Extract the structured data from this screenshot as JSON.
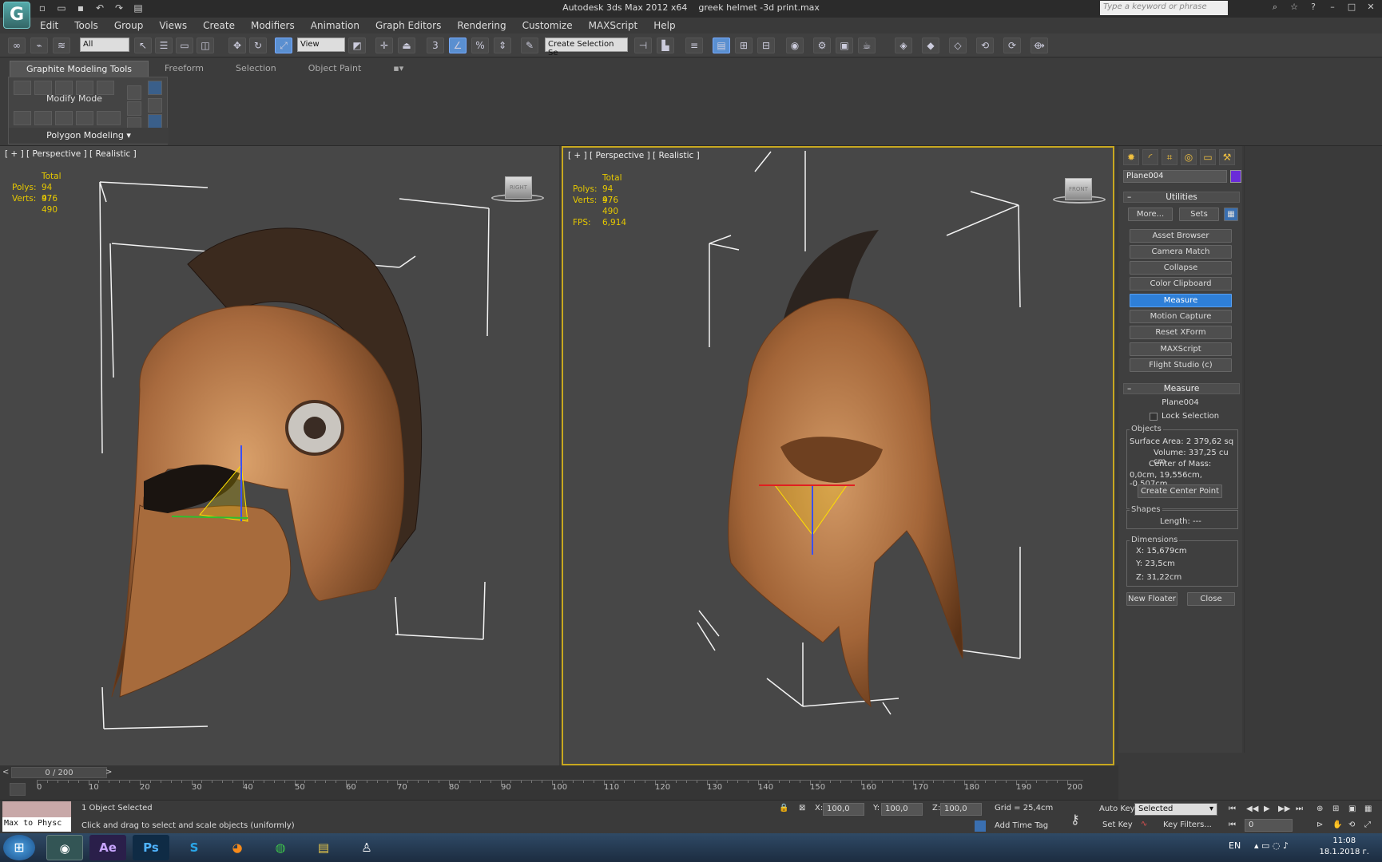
{
  "title_bar": {
    "app": "Autodesk 3ds Max  2012 x64",
    "file": "greek helmet -3d print.max",
    "search_placeholder": "Type a keyword or phrase"
  },
  "menu": [
    "Edit",
    "Tools",
    "Group",
    "Views",
    "Create",
    "Modifiers",
    "Animation",
    "Graph Editors",
    "Rendering",
    "Customize",
    "MAXScript",
    "Help"
  ],
  "toolbar": {
    "filter": "All",
    "ref_coord": "View",
    "selection_set": "Create Selection Se"
  },
  "ribbon": {
    "tabs": [
      "Graphite Modeling Tools",
      "Freeform",
      "Selection",
      "Object Paint"
    ],
    "mode": "Modify Mode",
    "polygon": "Polygon Modeling"
  },
  "viewport_left": {
    "label": "[ + ] [ Perspective ] [ Realistic ]",
    "total": "Total",
    "polys_label": "Polys:",
    "polys": "94 976",
    "verts_label": "Verts:",
    "verts": "47 490",
    "cube": "RIGHT"
  },
  "viewport_right": {
    "label": "[ + ] [ Perspective ] [ Realistic ]",
    "total": "Total",
    "polys_label": "Polys:",
    "polys": "94 976",
    "verts_label": "Verts:",
    "verts": "47 490",
    "fps_label": "FPS:",
    "fps": "6,914",
    "cube": "FRONT"
  },
  "command_panel": {
    "object_name": "Plane004",
    "object_color": "#6a2bd8",
    "utilities_header": "Utilities",
    "more": "More...",
    "sets": "Sets",
    "utilities": [
      "Asset Browser",
      "Camera Match",
      "Collapse",
      "Color Clipboard",
      "Measure",
      "Motion Capture",
      "Reset XForm",
      "MAXScript",
      "Flight Studio (c)"
    ],
    "measure_header": "Measure",
    "measure_obj": "Plane004",
    "lock_selection": "Lock Selection",
    "objects_title": "Objects",
    "surface_area": "Surface Area: 2 379,62 sq",
    "volume": "Volume:  337,25 cu cm",
    "center_of_mass": "Center of Mass:",
    "com_values": "0,0cm, 19,556cm, -0,507cm",
    "create_center": "Create Center Point",
    "shapes_title": "Shapes",
    "length": "Length: ---",
    "dims_title": "Dimensions",
    "dim_x": "X:   15,679cm",
    "dim_y": "Y:   23,5cm",
    "dim_z": "Z:   31,22cm",
    "new_floater": "New Floater",
    "close": "Close"
  },
  "timeline": {
    "frame": "0 / 200",
    "ticks": [
      "0",
      "10",
      "20",
      "30",
      "40",
      "50",
      "60",
      "70",
      "80",
      "90",
      "100",
      "110",
      "120",
      "130",
      "140",
      "150",
      "160",
      "170",
      "180",
      "190",
      "200"
    ]
  },
  "status": {
    "script": "Max to Physc",
    "selected": "1 Object Selected",
    "prompt": "Click and drag to select and scale objects (uniformly)",
    "x_label": "X:",
    "x": "100,0",
    "y_label": "Y:",
    "y": "100,0",
    "z_label": "Z:",
    "z": "100,0",
    "grid": "Grid = 25,4cm",
    "add_time_tag": "Add Time Tag",
    "auto_key": "Auto Key",
    "selected_dd": "Selected",
    "set_key": "Set Key",
    "key_filters": "Key Filters...",
    "frame_field": "0"
  },
  "taskbar": {
    "lang": "EN",
    "time": "11:08",
    "date": "18.1.2018 г.",
    "apps": [
      "3ds",
      "Ae",
      "Ps",
      "S",
      "ff",
      "ch",
      "fo",
      "zb"
    ]
  }
}
